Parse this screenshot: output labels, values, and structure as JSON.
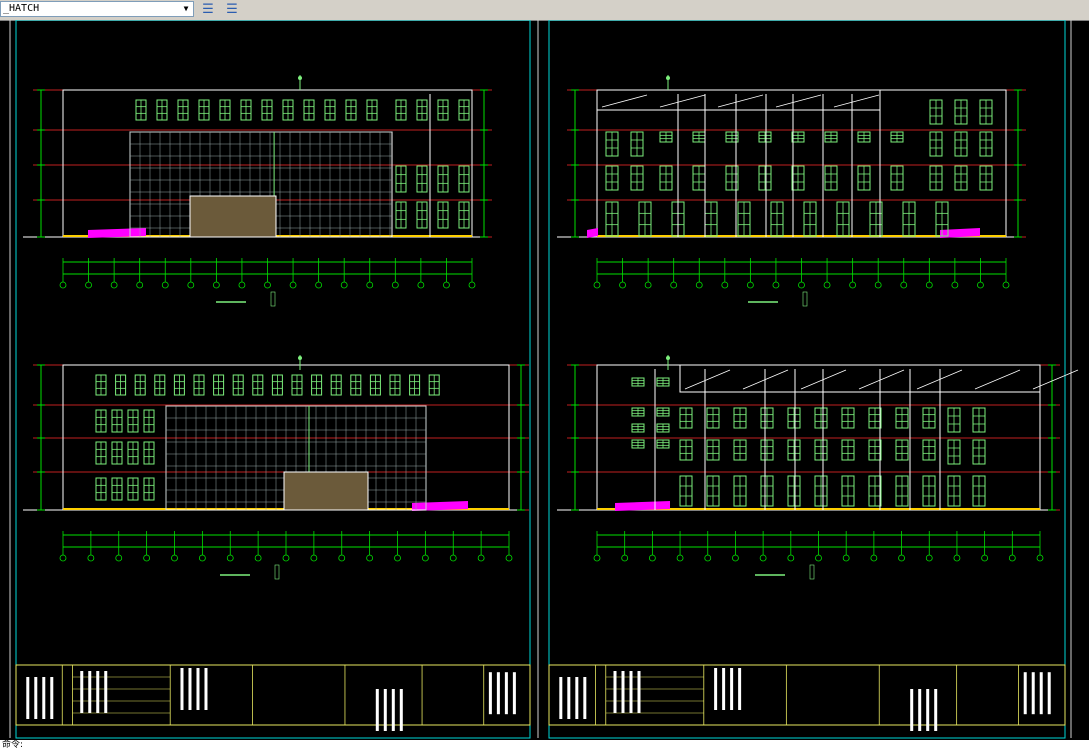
{
  "toolbar": {
    "layer_value": "_HATCH",
    "dropdown_arrow": "▼",
    "icons": [
      "layer-states-icon",
      "layer-previous-icon"
    ]
  },
  "drawing": {
    "background": "#000000",
    "colors": {
      "frame": "#00d7d7",
      "border": "#ffffff",
      "window": "#7df07d",
      "grid": "#ff2a2a",
      "ground": "#ffd000",
      "hatch": "#ff00ff",
      "dimension": "#00e000",
      "title_block": "#e8e860"
    },
    "sheets": [
      "left-sheet",
      "right-sheet"
    ],
    "elevations": [
      "top-left",
      "top-right",
      "bottom-left",
      "bottom-right"
    ]
  },
  "command_line": {
    "prompt": "命令: "
  }
}
